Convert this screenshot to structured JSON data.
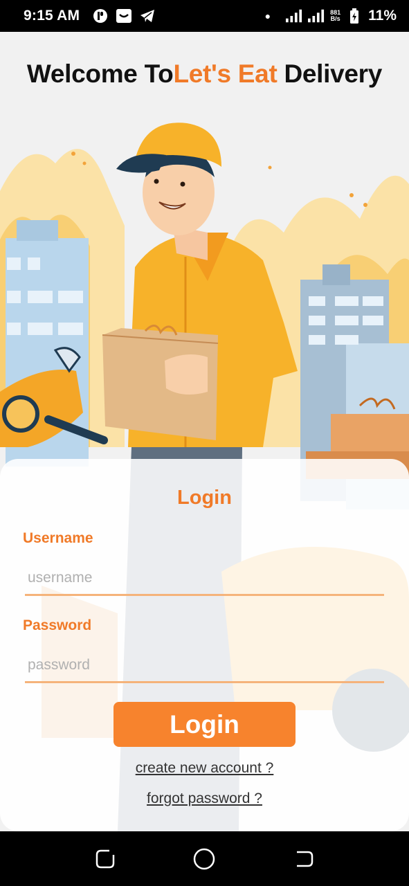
{
  "status_bar": {
    "time": "9:15 AM",
    "icons_left": [
      "app-icon",
      "sim-mail-icon",
      "telegram-icon"
    ],
    "net_speed_value": "881",
    "net_speed_unit": "B/s",
    "battery": "11%"
  },
  "header": {
    "prefix": "Welcome To",
    "brand": "Let's Eat",
    "suffix": " Delivery"
  },
  "login": {
    "title": "Login",
    "username_label": "Username",
    "username_placeholder": "username",
    "username_value": "",
    "password_label": "Password",
    "password_placeholder": "password",
    "password_value": "",
    "submit_label": "Login",
    "create_account_link": "create new account ?",
    "forgot_password_link": "forgot password ?"
  },
  "nav_bar": {
    "buttons": [
      "recents",
      "home",
      "back"
    ]
  },
  "colors": {
    "accent": "#f07a28",
    "button": "#f7832d",
    "underline": "#f5b37a"
  }
}
